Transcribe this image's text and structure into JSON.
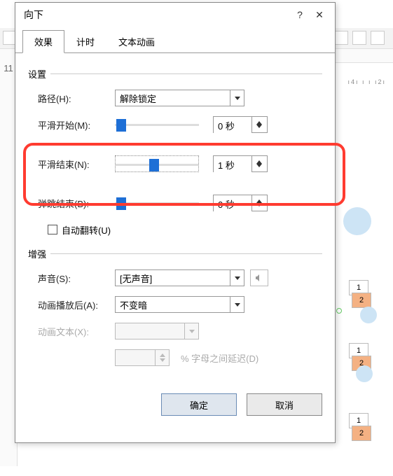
{
  "dialog": {
    "title": "向下",
    "help": "?",
    "close": "✕"
  },
  "tabs": {
    "effect": "效果",
    "timing": "计时",
    "textanim": "文本动画"
  },
  "groups": {
    "settings": "设置",
    "enhance": "增强"
  },
  "settings": {
    "path_label": "路径(H):",
    "path_value": "解除锁定",
    "smooth_start_label": "平滑开始(M):",
    "smooth_start_value": "0 秒",
    "smooth_end_label": "平滑结束(N):",
    "smooth_end_value": "1 秒",
    "bounce_end_label": "弹跳结束(B):",
    "bounce_end_value": "0 秒",
    "auto_reverse": "自动翻转(U)"
  },
  "enhance": {
    "sound_label": "声音(S):",
    "sound_value": "[无声音]",
    "after_label": "动画播放后(A):",
    "after_value": "不变暗",
    "animtext_label": "动画文本(X):",
    "delay_label": "% 字母之间延迟(D)"
  },
  "footer": {
    "ok": "确定",
    "cancel": "取消"
  },
  "bg": {
    "left_num": "11",
    "ruler": "ı4ı ı ı ı2ı",
    "card1": "1",
    "card2": "2"
  }
}
